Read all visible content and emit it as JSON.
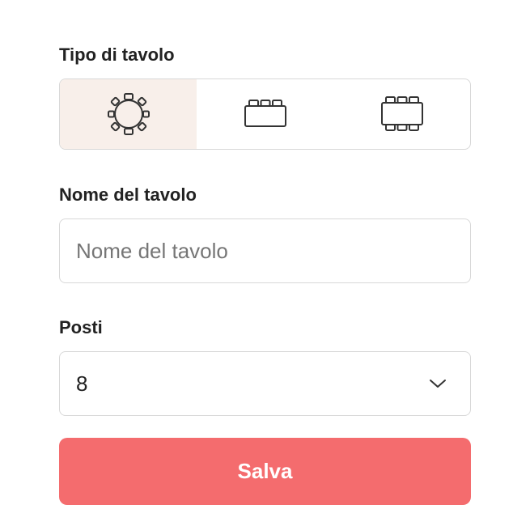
{
  "table_type": {
    "label": "Tipo di tavolo",
    "options": [
      {
        "icon": "round-table-icon",
        "selected": true
      },
      {
        "icon": "rectangular-table-one-side-icon",
        "selected": false
      },
      {
        "icon": "rectangular-table-two-sides-icon",
        "selected": false
      }
    ]
  },
  "table_name": {
    "label": "Nome del tavolo",
    "placeholder": "Nome del tavolo",
    "value": ""
  },
  "seats": {
    "label": "Posti",
    "value": "8",
    "chevron_icon": "chevron-down-icon"
  },
  "save": {
    "label": "Salva"
  },
  "colors": {
    "accent": "#f46c6e",
    "selected_bg": "#f8efea",
    "border": "#d8d8d8",
    "text": "#222222",
    "placeholder": "#767676"
  }
}
